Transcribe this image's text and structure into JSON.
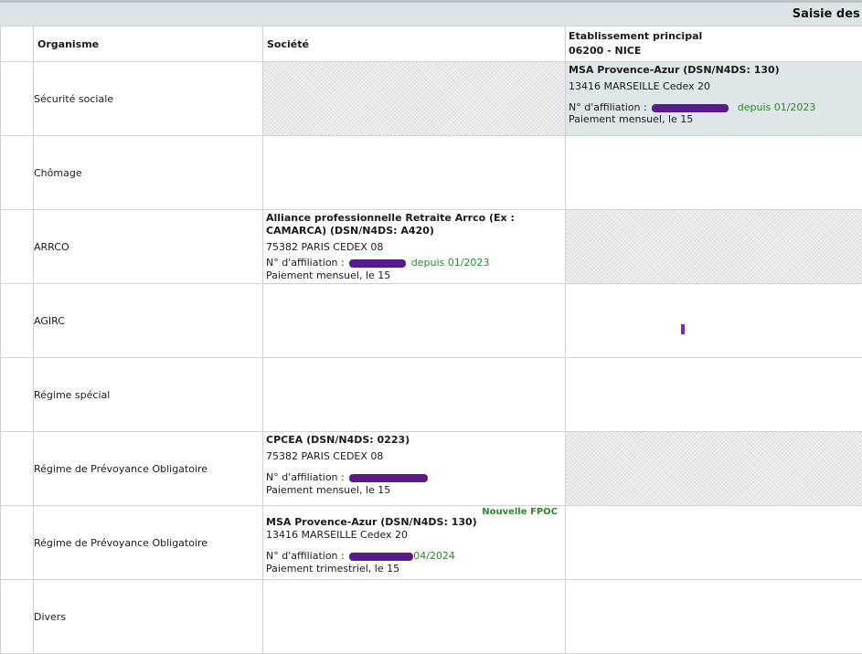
{
  "header": {
    "title": "Saisie des c"
  },
  "columns": {
    "organisme": "Organisme",
    "societe": "Société",
    "etablissement_line1": "Etablissement principal",
    "etablissement_line2": "06200 - NICE"
  },
  "rows": [
    {
      "label": "Sécurité sociale",
      "etablissement": {
        "name": "MSA Provence-Azur (DSN/N4DS: 130)",
        "address": "13416 MARSEILLE Cedex 20",
        "affiliation_label": "N° d'affiliation :",
        "since": "depuis 01/2023",
        "payment": "Paiement mensuel, le 15"
      }
    },
    {
      "label": "Chômage"
    },
    {
      "label": "ARRCO",
      "societe": {
        "name": "Alliance professionnelle Retraite Arrco (Ex : CAMARCA) (DSN/N4DS: A420)",
        "address": "75382 PARIS CEDEX 08",
        "affiliation_label": "N° d'affiliation :",
        "since": "depuis 01/2023",
        "payment": "Paiement mensuel, le 15"
      }
    },
    {
      "label": "AGIRC"
    },
    {
      "label": "Régime spécial"
    },
    {
      "label": "Régime de Prévoyance Obligatoire",
      "societe": {
        "name": "CPCEA (DSN/N4DS: 0223)",
        "address": "75382 PARIS CEDEX 08",
        "affiliation_label": "N° d'affiliation :",
        "payment": "Paiement mensuel, le 15"
      }
    },
    {
      "label": "Régime de Prévoyance Obligatoire",
      "societe": {
        "badge": "Nouvelle FPOC",
        "name": "MSA Provence-Azur (DSN/N4DS: 130)",
        "address": "13416 MARSEILLE Cedex 20",
        "affiliation_label": "N° d'affiliation :",
        "since": "04/2024",
        "payment": "Paiement trimestriel, le 15"
      }
    },
    {
      "label": "Divers"
    }
  ],
  "colors": {
    "accent_green": "#2a8a2a",
    "selected_bg": "#dfe6ea",
    "redaction": "#5a1a8a"
  }
}
